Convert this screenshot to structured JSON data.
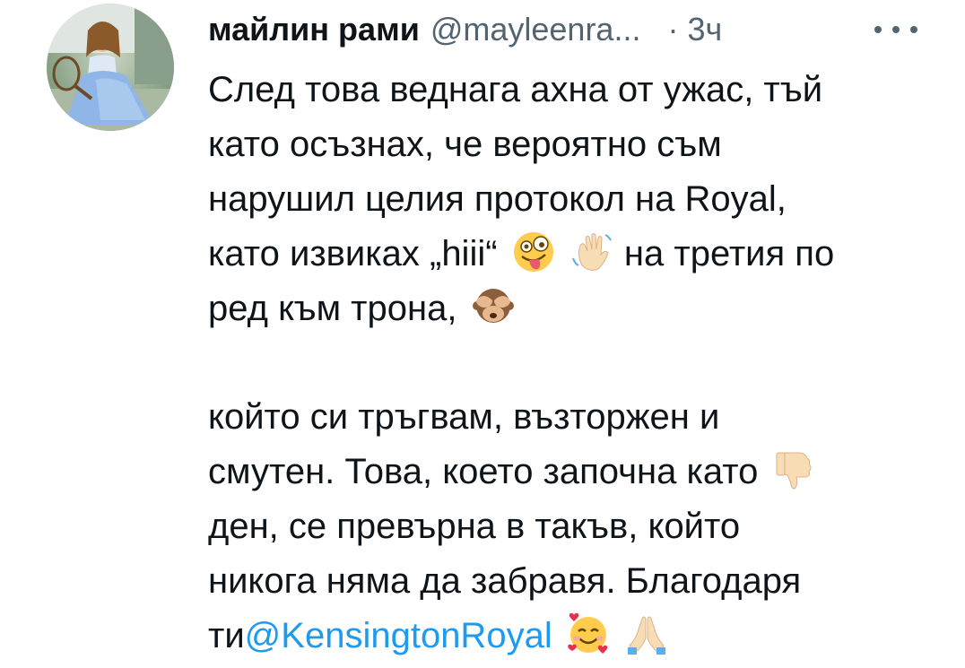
{
  "tweet": {
    "author": {
      "display_name": "майлин рами",
      "handle": "@mayleenra...",
      "avatar": "profile-photo"
    },
    "separator": "·",
    "timestamp": "3ч",
    "more_icon": "more-horizontal-icon",
    "text": {
      "line1": "След това веднага ахна от ужас, тъй",
      "line2": "като осъзнах, че вероятно съм",
      "line3": "нарушил целия протокол на Royal,",
      "line4_a": "като извиках „hiii“",
      "line4_b": "на третия по",
      "line5": "ред към трона,",
      "line6": "който си тръгвам, възторжен и",
      "line7": "смутен. Това, което започна като",
      "line8": "ден, се превърна в такъв, който",
      "line9": "никога няма да забравя. Благодаря",
      "line10_a": "ти",
      "line10_mention": "@KensingtonRoyal"
    },
    "emojis": {
      "zany_face": "zany-face-emoji",
      "waving_hand": "waving-hand-emoji",
      "see_no_evil": "see-no-evil-monkey-emoji",
      "thumbs_down": "thumbs-down-emoji",
      "smiling_hearts": "smiling-face-with-hearts-emoji",
      "folded_hands": "folded-hands-emoji"
    },
    "colors": {
      "text": "#0f1419",
      "secondary": "#536471",
      "link": "#1d9bf0"
    }
  }
}
